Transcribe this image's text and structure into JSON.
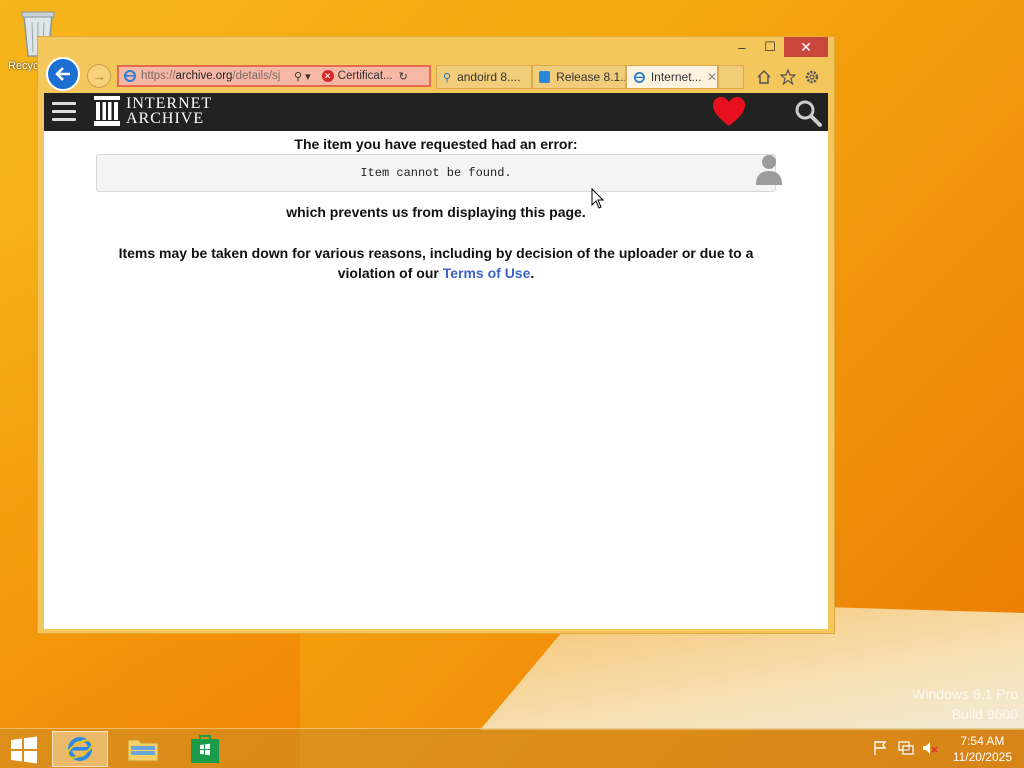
{
  "desktop": {
    "recycle_bin_label": "Recycle Bin",
    "watermark_line1": "Windows 8.1 Pro",
    "watermark_line2": "Build 9600"
  },
  "window": {
    "minimize": "–",
    "maximize": "☐",
    "close": "✕"
  },
  "address_bar": {
    "scheme": "https://",
    "host": "archive.org",
    "path": "/details/sj",
    "cert_label": "Certificat..."
  },
  "tabs": [
    {
      "label": "andoird 8....",
      "icon": "search-icon"
    },
    {
      "label": "Release 8.1...",
      "icon": "diamond-icon"
    },
    {
      "label": "Internet...",
      "icon": "ie-icon",
      "active": true
    }
  ],
  "site": {
    "logo_line1": "INTERNET",
    "logo_line2": "ARCHIVE",
    "heart_color": "#e8101c"
  },
  "page": {
    "title": "The item you have requested had an error:",
    "error_message": "Item cannot be found.",
    "line2": "which prevents us from displaying this page.",
    "para_text": "Items may be taken down for various reasons, including by decision of the uploader or due to a violation of our ",
    "terms_link": "Terms of Use",
    "para_end": "."
  },
  "taskbar": {
    "time": "7:54 AM",
    "date": "11/20/2025"
  }
}
